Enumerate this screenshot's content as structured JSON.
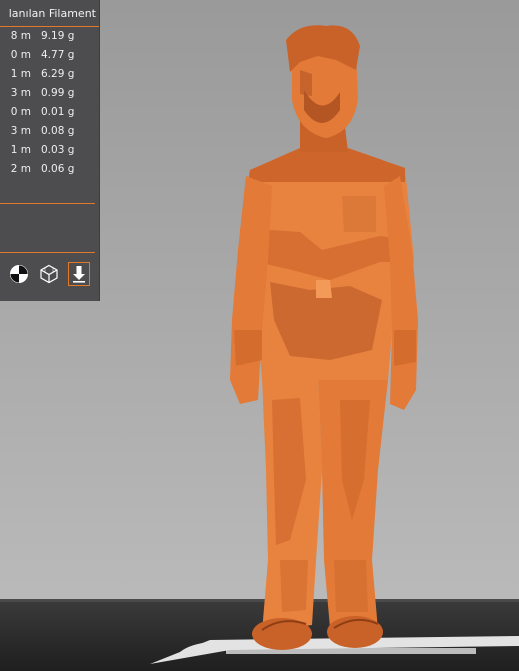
{
  "panel": {
    "header": "lanılan Filament",
    "rows": [
      {
        "length": "8 m",
        "weight": "9.19 g"
      },
      {
        "length": "0 m",
        "weight": "4.77 g"
      },
      {
        "length": "1 m",
        "weight": "6.29 g"
      },
      {
        "length": "3 m",
        "weight": "0.99 g"
      },
      {
        "length": "0 m",
        "weight": "0.01 g"
      },
      {
        "length": "3 m",
        "weight": "0.08 g"
      },
      {
        "length": "1 m",
        "weight": "0.03 g"
      },
      {
        "length": "2 m",
        "weight": "0.06 g"
      }
    ],
    "view_icons": [
      "center-of-mass-icon",
      "wireframe-cube-icon",
      "drop-to-bed-icon"
    ]
  },
  "colors": {
    "panel_bg": "#4d4d4f",
    "accent": "#e07a2a",
    "model": "#e8823f",
    "viewport_top": "#9a9a9a",
    "bed": "#2b2b2b"
  }
}
